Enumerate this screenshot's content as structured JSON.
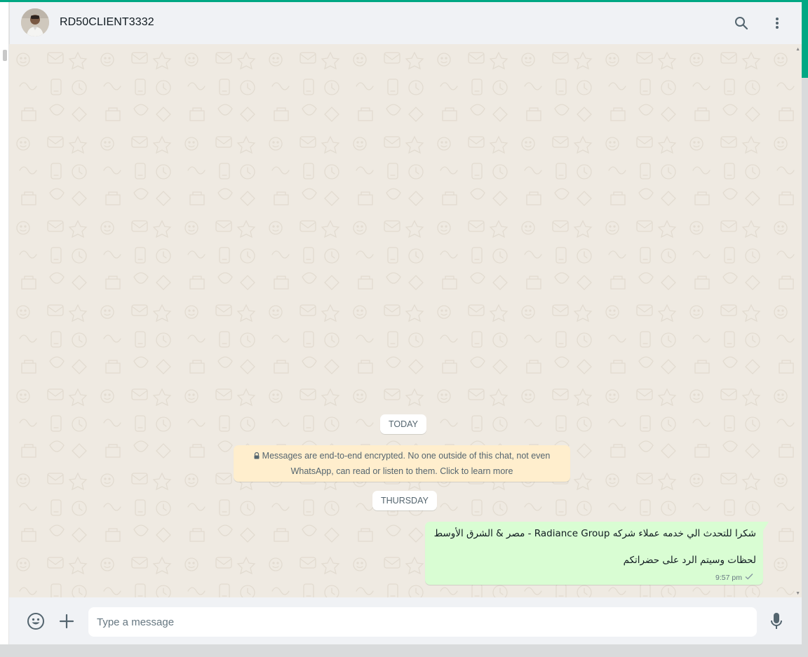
{
  "header": {
    "contact_name": "RD50CLIENT3332",
    "icons": [
      "avatar",
      "search-icon",
      "menu-icon"
    ]
  },
  "chat": {
    "date_today": "TODAY",
    "encryption_notice": {
      "line1": "Messages are end-to-end encrypted. No one outside of this chat, not even",
      "line2": "WhatsApp, can read or listen to them. Click to learn more",
      "icon": "lock-icon"
    },
    "date_thursday": "THURSDAY",
    "message": {
      "line1": "شكرا للتحدث الي خدمه عملاء شركه Radiance Group - مصر & الشرق الأوسط",
      "line2": "لحظات وسيتم الرد على حضراتكم",
      "time": "9:57 pm",
      "status_icon": "single-check-icon"
    }
  },
  "footer": {
    "placeholder": "Type a message",
    "icons": [
      "emoji-icon",
      "attach-plus-icon",
      "microphone-icon"
    ]
  },
  "colors": {
    "accent": "#00a884",
    "chat_background": "#efeae2",
    "outgoing_bubble": "#d9fdd3",
    "notice_background": "#ffeecd",
    "panel": "#f0f2f5"
  }
}
